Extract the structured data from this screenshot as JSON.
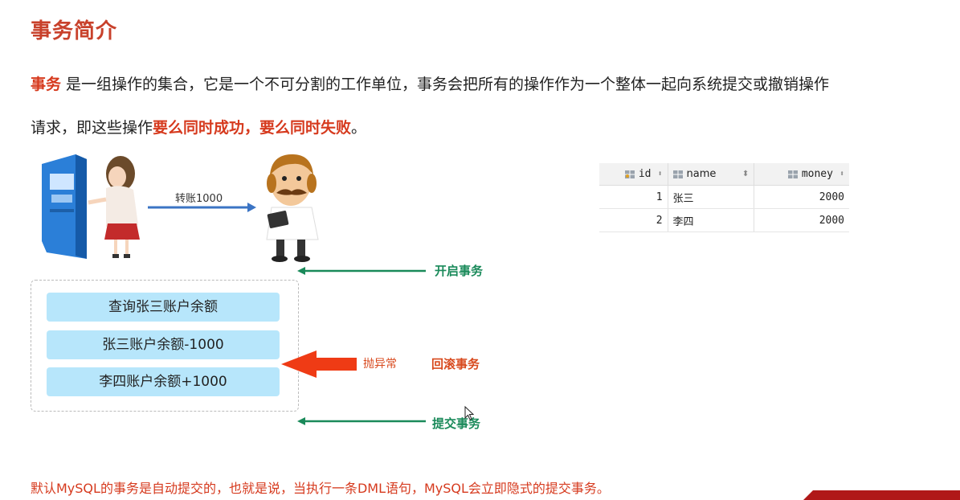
{
  "title": "事务简介",
  "intro": {
    "term": "事务",
    "line1_rest": " 是一组操作的集合，它是一个不可分割的工作单位，事务会把所有的操作作为一个整体一起向系统提交或撤销操作",
    "line2_prefix": "请求，即这些操作",
    "line2_highlight": "要么同时成功，要么同时失败",
    "line2_suffix": "。"
  },
  "diagram": {
    "transfer_label": "转账1000",
    "atm_text": "ATM",
    "operations": [
      "查询张三账户余额",
      "张三账户余额-1000",
      "李四账户余额+1000"
    ],
    "begin_label": "开启事务",
    "exception_label": "抛异常",
    "rollback_label": "回滚事务",
    "commit_label": "提交事务",
    "colors": {
      "green": "#1a8a5a",
      "orange": "#d84a1e",
      "box": "#b7e6fb"
    }
  },
  "table": {
    "columns": [
      "id",
      "name",
      "money"
    ],
    "rows": [
      [
        "1",
        "张三",
        "2000"
      ],
      [
        "2",
        "李四",
        "2000"
      ]
    ]
  },
  "footer": "默认MySQL的事务是自动提交的，也就是说，当执行一条DML语句，MySQL会立即隐式的提交事务。"
}
